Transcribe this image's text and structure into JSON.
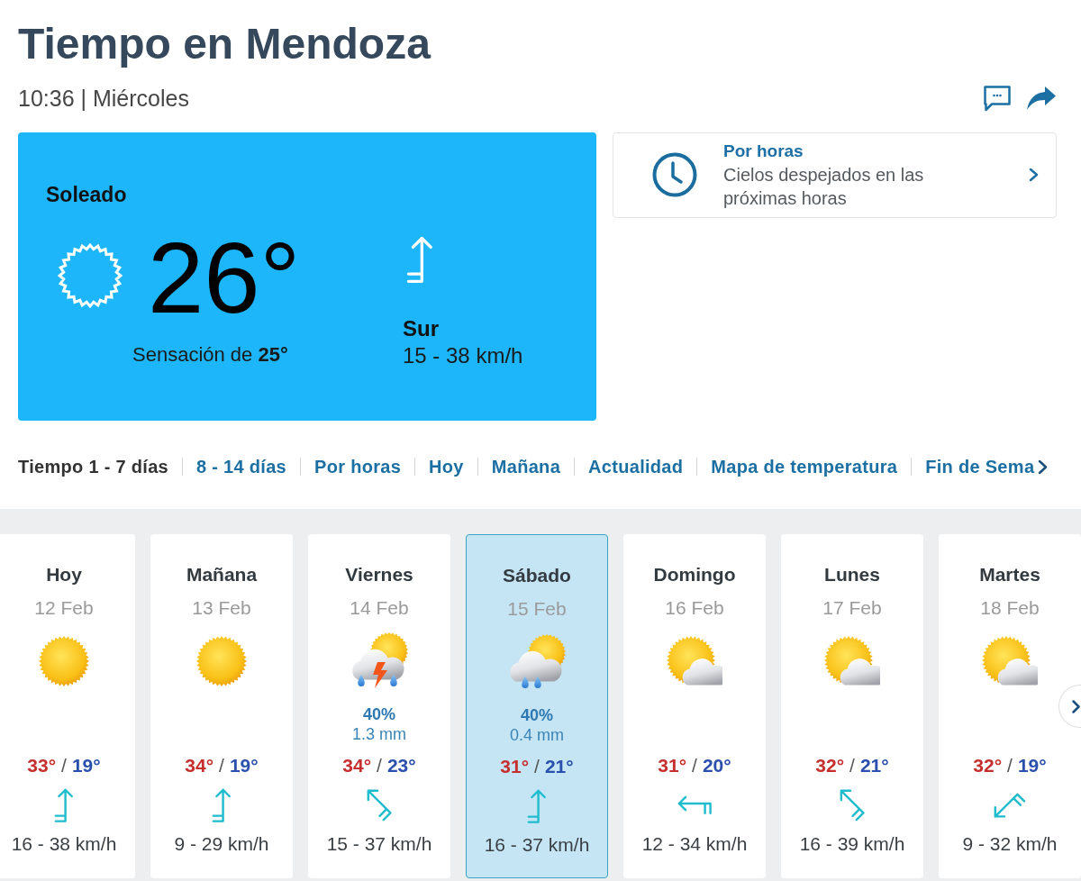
{
  "header": {
    "title": "Tiempo en Mendoza",
    "subtitle": "10:36 | Miércoles"
  },
  "current": {
    "condition": "Soleado",
    "temperature": "26°",
    "feels_like": "Sensación de **25°**",
    "wind": {
      "kind": "south",
      "direction": "Sur",
      "speed": "15 - 38 km/h"
    }
  },
  "hourly": {
    "title": "Por horas",
    "summary": "Cielos despejados en las próximas horas"
  },
  "nav": [
    {
      "label": "Tiempo 1 - 7 días",
      "selected": true
    },
    {
      "label": "8 - 14 días",
      "selected": false
    },
    {
      "label": "Por horas",
      "selected": false
    },
    {
      "label": "Hoy",
      "selected": false
    },
    {
      "label": "Mañana",
      "selected": false
    },
    {
      "label": "Actualidad",
      "selected": false
    },
    {
      "label": "Mapa de temperatura",
      "selected": false
    },
    {
      "label": "Fin de Sema",
      "selected": false
    }
  ],
  "days": [
    {
      "day": "Hoy",
      "date": "12 Feb",
      "kind": "sun",
      "max": "33°",
      "separator": "/",
      "min": "19°",
      "wind": {
        "kind": "south",
        "speed": "16 - 38 km/h"
      },
      "selected": false
    },
    {
      "day": "Mañana",
      "date": "13 Feb",
      "kind": "sun",
      "max": "34°",
      "separator": "/",
      "min": "19°",
      "wind": {
        "kind": "south",
        "speed": "9 - 29 km/h"
      },
      "selected": false
    },
    {
      "day": "Viernes",
      "date": "14 Feb",
      "kind": "storm",
      "precip_chance": "40%",
      "precip_amount": "1.3 mm",
      "max": "34°",
      "separator": "/",
      "min": "23°",
      "wind": {
        "kind": "southeast",
        "speed": "15 - 37 km/h"
      },
      "selected": false
    },
    {
      "day": "Sábado",
      "date": "15 Feb",
      "kind": "rain",
      "precip_chance": "40%",
      "precip_amount": "0.4 mm",
      "max": "31°",
      "separator": "/",
      "min": "21°",
      "wind": {
        "kind": "south",
        "speed": "16 - 37 km/h"
      },
      "selected": true
    },
    {
      "day": "Domingo",
      "date": "16 Feb",
      "kind": "cloud",
      "max": "31°",
      "separator": "/",
      "min": "20°",
      "wind": {
        "kind": "east",
        "speed": "12 - 34 km/h"
      },
      "selected": false
    },
    {
      "day": "Lunes",
      "date": "17 Feb",
      "kind": "cloud",
      "max": "32°",
      "separator": "/",
      "min": "21°",
      "wind": {
        "kind": "southeast",
        "speed": "16 - 39 km/h"
      },
      "selected": false
    },
    {
      "day": "Martes",
      "date": "18 Feb",
      "kind": "cloud",
      "max": "32°",
      "separator": "/",
      "min": "19°",
      "wind": {
        "kind": "northeast",
        "speed": "9 - 32 km/h"
      },
      "selected": false
    }
  ]
}
